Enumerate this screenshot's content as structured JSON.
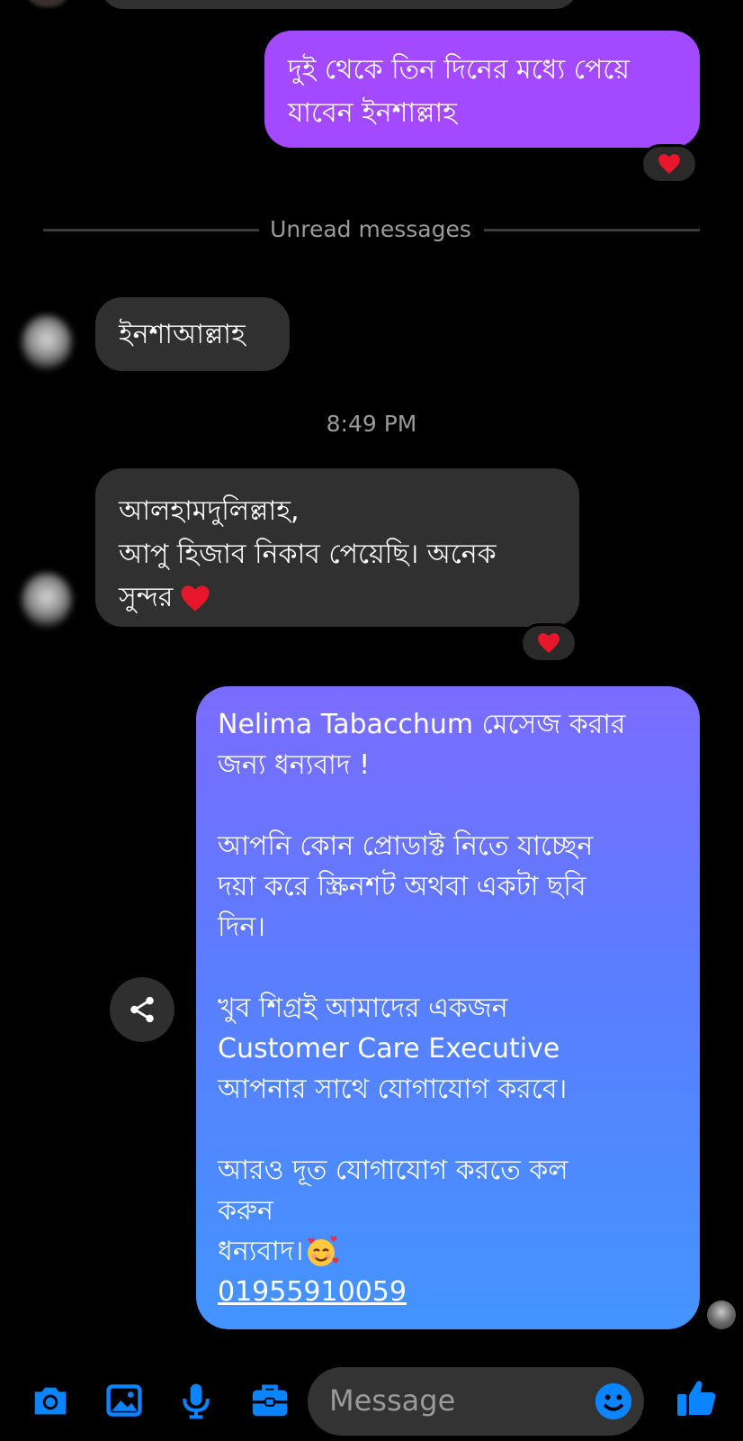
{
  "messages": {
    "outgoing_1": "দুই থেকে তিন দিনের মধ্যে পেয়ে যাবেন ইনশাল্লাহ",
    "unread_divider": "Unread messages",
    "incoming_1": "ইনশাআল্লাহ",
    "timestamp": "8:49 PM",
    "incoming_2_line1": "আলহামদুলিল্লাহ,",
    "incoming_2_line2": "আপু হিজাব নিকাব পেয়েছি। অনেক",
    "incoming_2_line3": "সুন্দর",
    "auto_reply": {
      "line1": "Nelima Tabacchum  মেসেজ করার",
      "line2": "জন্য ধন্যবাদ !",
      "line3": "আপনি কোন প্রোডাক্ট নিতে যাচ্ছেন",
      "line4": "দয়া করে স্ক্রিনশট অথবা একটা ছবি",
      "line5": "দিন।",
      "line6": "খুব শিগ্রই আমাদের একজন",
      "line7": "Customer Care Executive",
      "line8": "আপনার সাথে যোগাযোগ করবে।",
      "line9": "আরও দূত যোগাযোগ করতে কল",
      "line10": "করুন",
      "line11": "ধন্যবাদ।",
      "phone": "01955910059"
    }
  },
  "composer": {
    "placeholder": "Message"
  },
  "icons": {
    "camera": "camera-icon",
    "gallery": "gallery-icon",
    "mic": "mic-icon",
    "briefcase": "briefcase-icon",
    "emoji": "emoji-icon",
    "like": "thumbs-up-icon",
    "share": "share-icon",
    "heart": "heart-icon",
    "smiling_face_with_hearts": "smiling-face-with-hearts-icon"
  },
  "colors": {
    "outgoing_bubble": "#a349ff",
    "incoming_bubble": "#303030",
    "accent_blue": "#0a84ff",
    "heart": "#e8162a",
    "gradient_top": "#7b6cff",
    "gradient_bottom": "#4394ff"
  }
}
